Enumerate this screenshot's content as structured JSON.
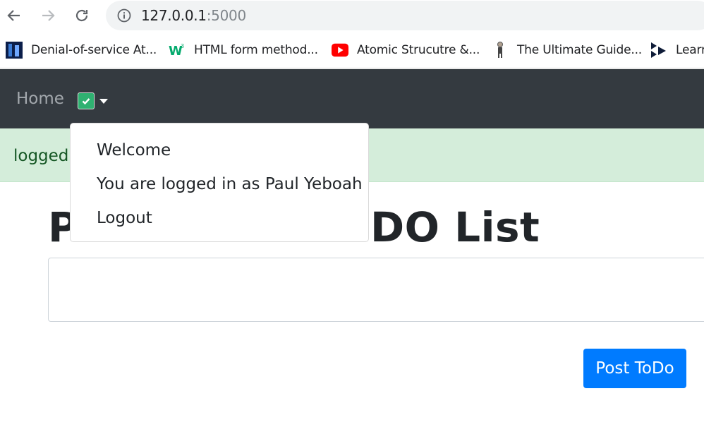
{
  "browser": {
    "url_host": "127.0.0.1",
    "url_port": ":5000",
    "icons": {
      "back": "back-arrow-icon",
      "forward": "forward-arrow-icon",
      "reload": "reload-icon",
      "info": "info-icon"
    },
    "bookmarks": [
      {
        "label": "Denial-of-service At...",
        "icon": "bookmark-image-icon"
      },
      {
        "label": "HTML form method...",
        "icon": "w3schools-icon"
      },
      {
        "label": "Atomic Strucutre &...",
        "icon": "youtube-icon"
      },
      {
        "label": "The Ultimate Guide...",
        "icon": "figure-icon"
      },
      {
        "label": "Learr",
        "icon": "play-logo-icon"
      }
    ]
  },
  "navbar": {
    "home_label": "Home",
    "user_icon": "check-icon",
    "bg_color": "#343a40"
  },
  "flash": {
    "text": "logged",
    "bg_color": "#d4edda"
  },
  "main": {
    "title_left": "P",
    "title_right": "DO List",
    "input_value": "",
    "post_button_label": "Post ToDo",
    "accent_color": "#007bff"
  },
  "dropdown": {
    "items": [
      {
        "label": "Welcome"
      },
      {
        "label": "You are logged in as Paul Yeboah"
      },
      {
        "label": "Logout"
      }
    ]
  }
}
